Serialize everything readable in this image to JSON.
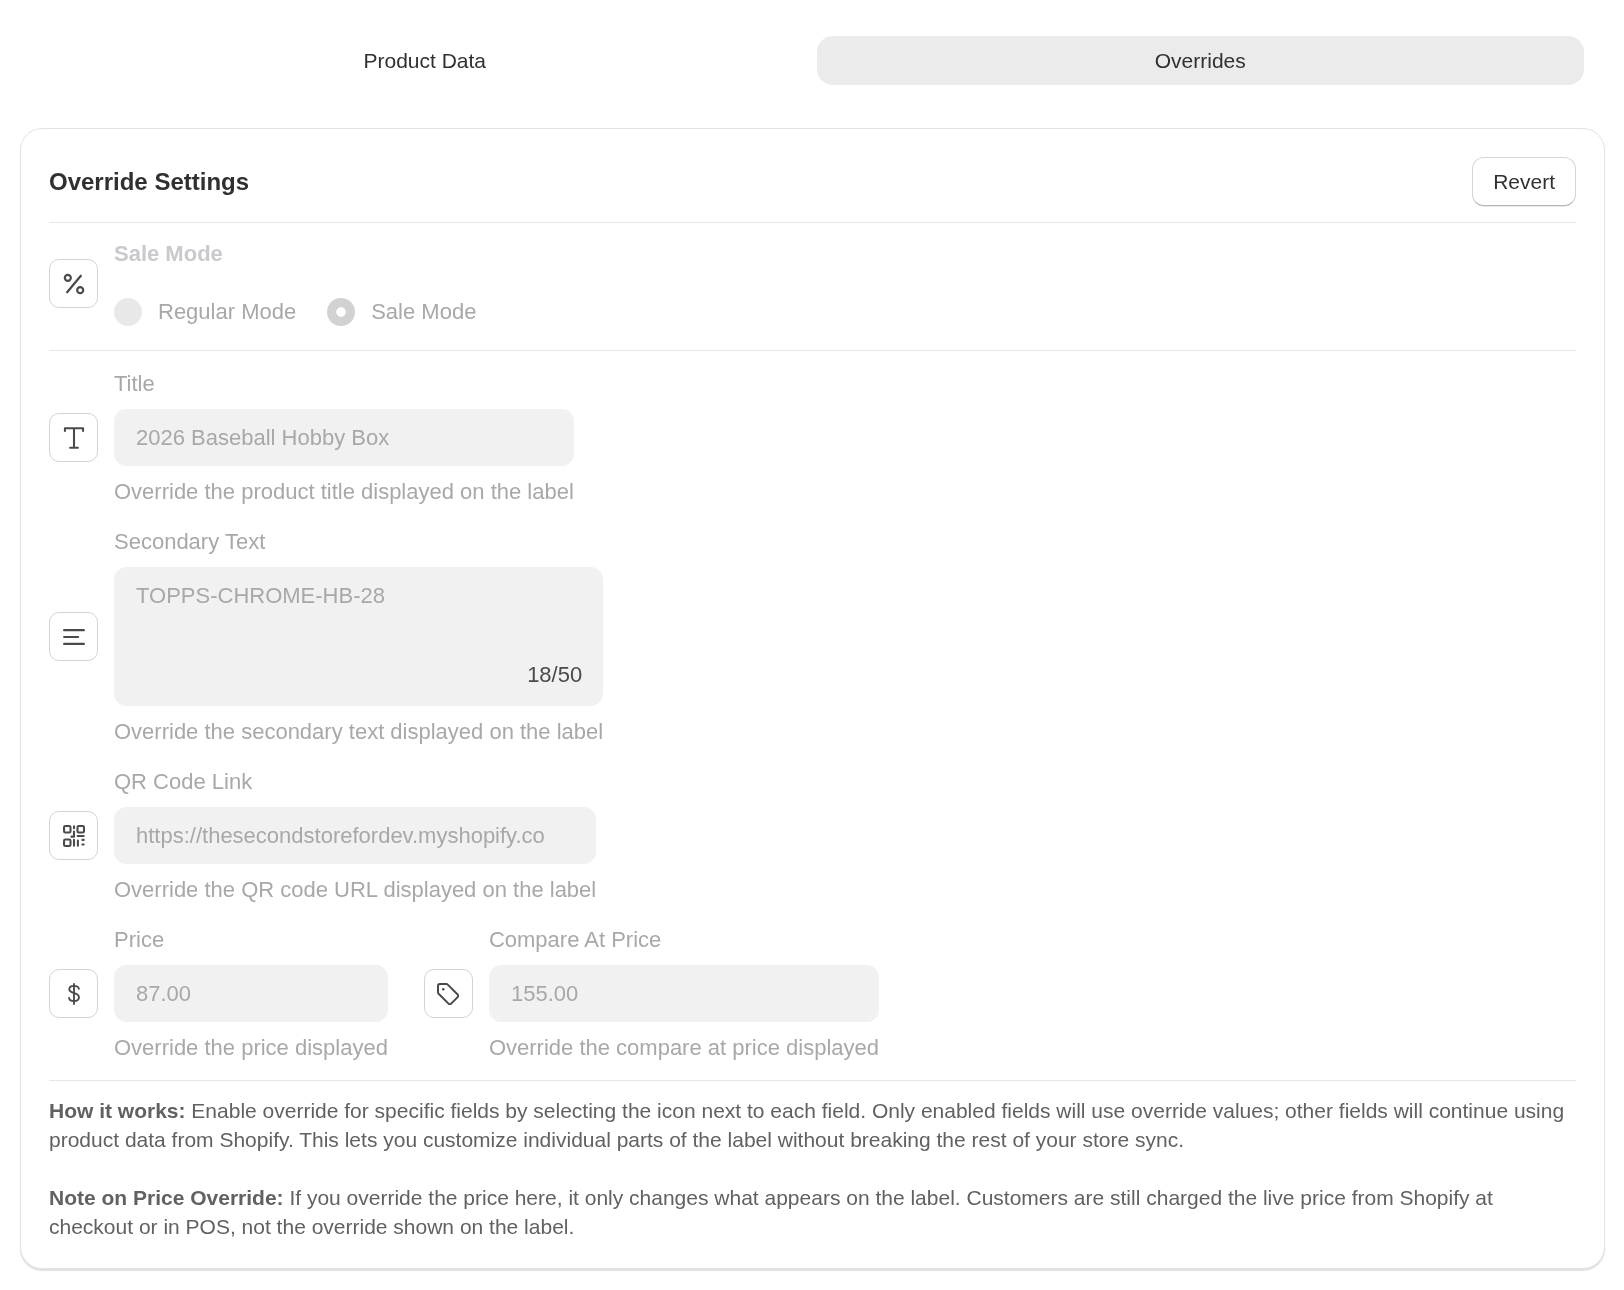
{
  "tabs": [
    {
      "label": "Product Data",
      "selected": false
    },
    {
      "label": "Overrides",
      "selected": true
    }
  ],
  "card": {
    "title": "Override Settings",
    "revert_button": "Revert"
  },
  "sale_mode": {
    "label": "Sale Mode",
    "disabled": true,
    "options": [
      {
        "label": "Regular Mode",
        "selected": false
      },
      {
        "label": "Sale Mode",
        "selected": true
      }
    ]
  },
  "title_field": {
    "label": "Title",
    "value": "2026 Baseball Hobby Box",
    "help_text": "Override the product title displayed on the label",
    "disabled": true
  },
  "secondary_text_field": {
    "label": "Secondary Text",
    "value": "TOPPS-CHROME-HB-28",
    "counter": "18/50",
    "help_text": "Override the secondary text displayed on the label",
    "disabled": true
  },
  "qr_code_field": {
    "label": "QR Code Link",
    "value": "https://thesecondstorefordev.myshopify.co",
    "help_text": "Override the QR code URL displayed on the label",
    "disabled": true
  },
  "price_field": {
    "label": "Price",
    "value": "87.00",
    "help_text": "Override the price displayed",
    "disabled": true
  },
  "compare_at_price_field": {
    "label": "Compare At Price",
    "value": "155.00",
    "help_text": "Override the compare at price displayed",
    "disabled": true
  },
  "notes": [
    "**How it works:** Enable override for specific fields by selecting the icon next to each field. Only enabled fields will use override values; other fields will continue using product data from Shopify. This lets you customize individual parts of the label without breaking the rest of your store sync.",
    "**Note on Price Override:** If you override the price here, it only changes what appears on the label. Customers are still charged the live price from Shopify at checkout or in POS, not the override shown on the label."
  ]
}
